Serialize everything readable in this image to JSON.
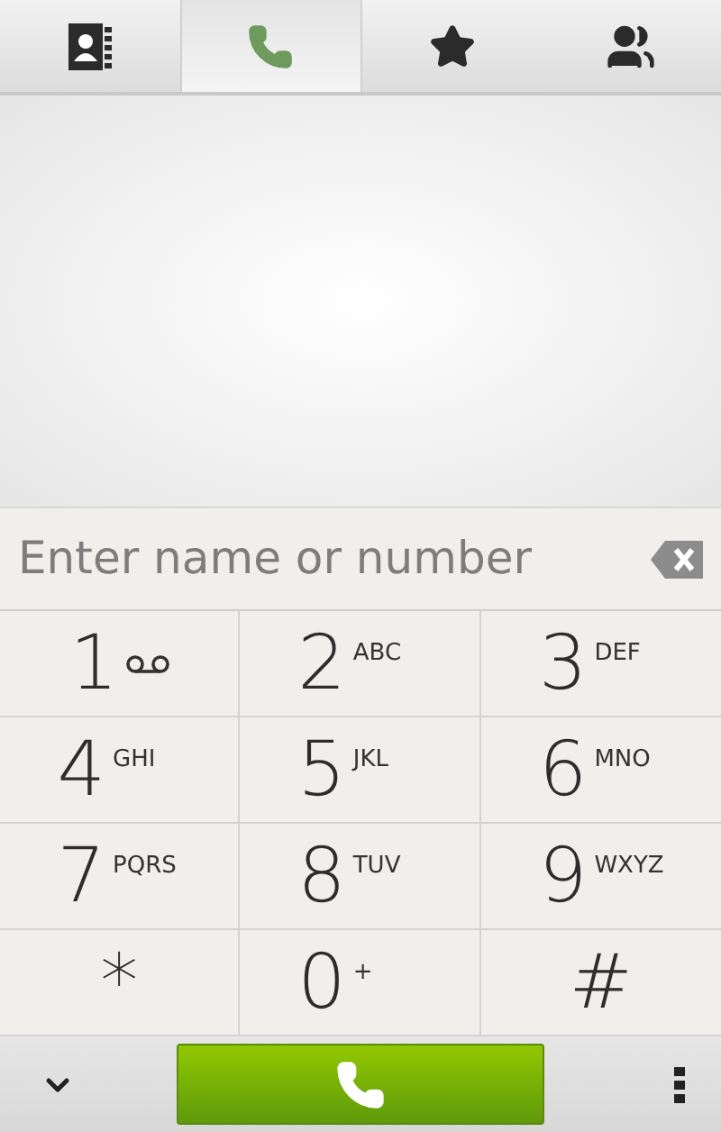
{
  "tabs": [
    {
      "kind": "contacts",
      "selected": false
    },
    {
      "kind": "phone",
      "selected": true
    },
    {
      "kind": "favorites",
      "selected": false
    },
    {
      "kind": "groups",
      "selected": false
    }
  ],
  "dial_field": {
    "placeholder": "Enter name or number"
  },
  "keypad": [
    {
      "digit": "1",
      "kind": "voicemail"
    },
    {
      "digit": "2",
      "letters": "ABC"
    },
    {
      "digit": "3",
      "letters": "DEF"
    },
    {
      "digit": "4",
      "letters": "GHI"
    },
    {
      "digit": "5",
      "letters": "JKL"
    },
    {
      "digit": "6",
      "letters": "MNO"
    },
    {
      "digit": "7",
      "letters": "PQRS"
    },
    {
      "digit": "8",
      "letters": "TUV"
    },
    {
      "digit": "9",
      "letters": "WXYZ"
    },
    {
      "digit": "*"
    },
    {
      "digit": "0",
      "letters": "+"
    },
    {
      "digit": "#"
    }
  ]
}
